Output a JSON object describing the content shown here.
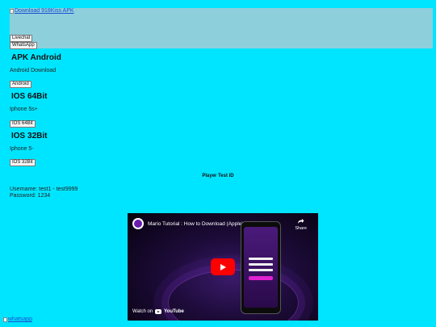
{
  "banner": {
    "link_text": "Download 918Kiss APK"
  },
  "contact": {
    "livechat_label": "Livechat",
    "whatsapp_label": "WhatsApp"
  },
  "apk_android": {
    "heading": "APK Android",
    "description": "Android Download",
    "button": "Android"
  },
  "ios_64": {
    "heading": "IOS 64Bit",
    "description": "Iphone 5s+",
    "button": "IOS 64Bit"
  },
  "ios_32": {
    "heading": "IOS 32Bit",
    "description": "Iphone 5-",
    "button": "IOS 32Bit"
  },
  "test_id": {
    "label": "Player Test ID",
    "username": "Username: test1 - test9999",
    "password": "Password: 1234"
  },
  "video": {
    "title": "Mario Tutorial : How to Download (Apple)",
    "share_label": "Share",
    "watch_on": "Watch on",
    "platform": "YouTube"
  },
  "footer": {
    "whatsapp_link": "whatsapp"
  }
}
